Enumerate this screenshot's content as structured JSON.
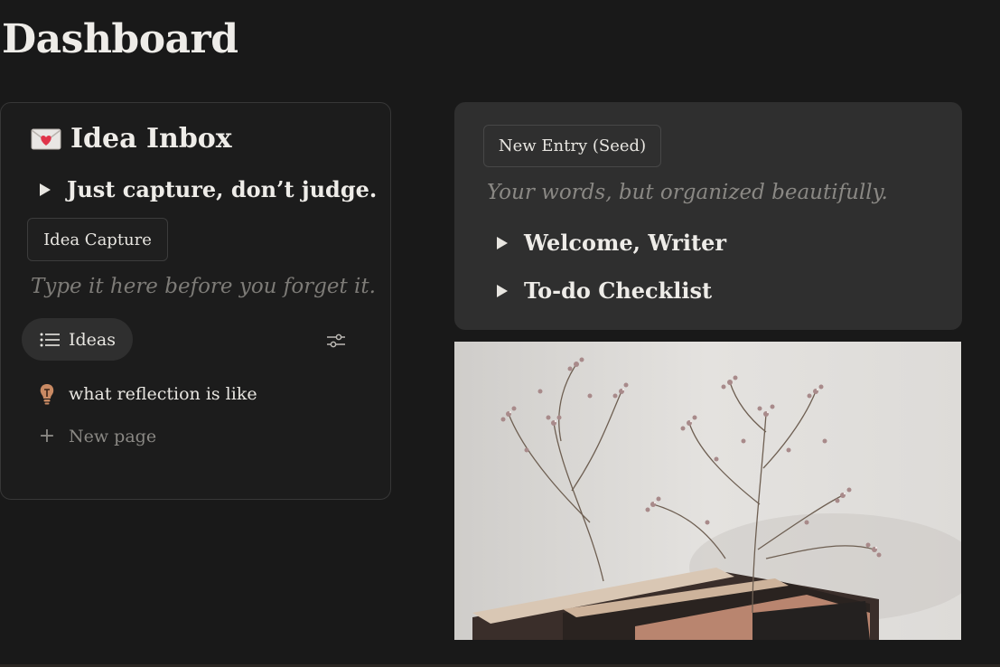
{
  "page": {
    "title": "Dashboard"
  },
  "inbox": {
    "heading": "Idea Inbox",
    "heading_icon": "envelope-heart-icon",
    "toggle_label": "Just capture, don’t judge.",
    "capture_button": "Idea Capture",
    "placeholder": "Type it here before you forget it.",
    "view_tab": "Ideas",
    "items": [
      {
        "label": "what reflection is like",
        "icon": "lightbulb-icon"
      }
    ],
    "new_page_label": "New page"
  },
  "entry": {
    "button_label": "New Entry (Seed)",
    "tagline": "Your words, but organized beautifully.",
    "toggles": [
      {
        "label": "Welcome, Writer"
      },
      {
        "label": "To-do Checklist"
      }
    ]
  },
  "image": {
    "subject": "dried-flowers-on-books-photo"
  },
  "colors": {
    "background": "#191919",
    "card_dark": "#1c1c1c",
    "card_gray": "#2f2f2f",
    "text": "#e8e6e1",
    "muted": "#7d7b77"
  }
}
